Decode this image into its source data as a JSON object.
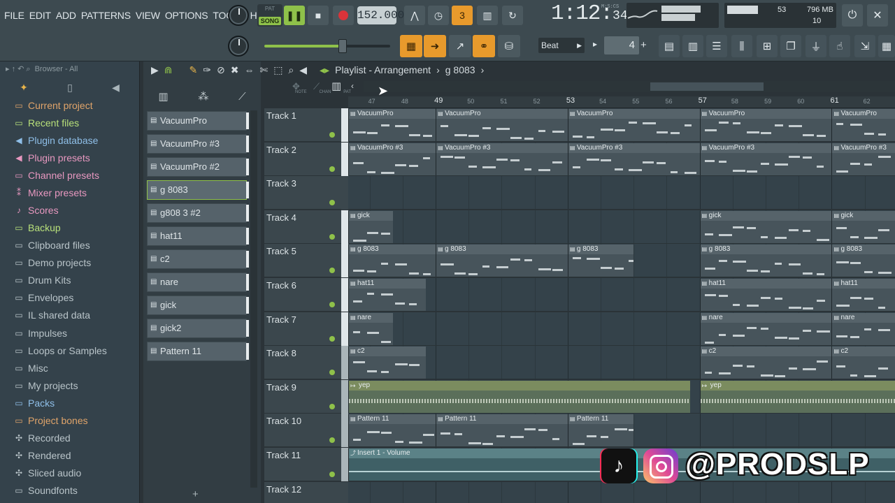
{
  "menu": [
    "FILE",
    "EDIT",
    "ADD",
    "PATTERNS",
    "VIEW",
    "OPTIONS",
    "TOOLS",
    "HELP"
  ],
  "transport": {
    "pat_label": "PAT",
    "song_label": "SONG",
    "tempo": "152.000",
    "time_main": "1:12:",
    "time_small": "34",
    "time_unit": "M:S:CS"
  },
  "cpu": {
    "cpu": "53",
    "memory": "796 MB",
    "polyphony": "10"
  },
  "snap": {
    "label": "Beat",
    "step": "4"
  },
  "browser": {
    "title": "Browser - All",
    "items": [
      {
        "label": "Current project",
        "icon": "folder-icon",
        "color": "#e0a46a"
      },
      {
        "label": "Recent files",
        "icon": "folder-icon",
        "color": "#b8e07a"
      },
      {
        "label": "Plugin database",
        "icon": "plug-icon",
        "color": "#8fbfe8"
      },
      {
        "label": "Plugin presets",
        "icon": "plug-icon",
        "color": "#e898c0"
      },
      {
        "label": "Channel presets",
        "icon": "folder-icon",
        "color": "#e898c0"
      },
      {
        "label": "Mixer presets",
        "icon": "mixer-icon",
        "color": "#e898c0"
      },
      {
        "label": "Scores",
        "icon": "note-icon",
        "color": "#e898c0"
      },
      {
        "label": "Backup",
        "icon": "folder-icon",
        "color": "#b8e07a"
      },
      {
        "label": "Clipboard files",
        "icon": "folder-icon",
        "color": "#b9c4c9"
      },
      {
        "label": "Demo projects",
        "icon": "folder-icon",
        "color": "#b9c4c9"
      },
      {
        "label": "Drum Kits",
        "icon": "folder-icon",
        "color": "#b9c4c9"
      },
      {
        "label": "Envelopes",
        "icon": "folder-icon",
        "color": "#b9c4c9"
      },
      {
        "label": "IL shared data",
        "icon": "folder-icon",
        "color": "#b9c4c9"
      },
      {
        "label": "Impulses",
        "icon": "folder-icon",
        "color": "#b9c4c9"
      },
      {
        "label": "Loops or Samples",
        "icon": "folder-icon",
        "color": "#b9c4c9"
      },
      {
        "label": "Misc",
        "icon": "folder-icon",
        "color": "#b9c4c9"
      },
      {
        "label": "My projects",
        "icon": "folder-icon",
        "color": "#b9c4c9"
      },
      {
        "label": "Packs",
        "icon": "folder-icon",
        "color": "#8fbfe8"
      },
      {
        "label": "Project bones",
        "icon": "folder-icon",
        "color": "#e0a46a"
      },
      {
        "label": "Recorded",
        "icon": "mic-icon",
        "color": "#b9c4c9"
      },
      {
        "label": "Rendered",
        "icon": "mic-icon",
        "color": "#b9c4c9"
      },
      {
        "label": "Sliced audio",
        "icon": "mic-icon",
        "color": "#b9c4c9"
      },
      {
        "label": "Soundfonts",
        "icon": "folder-icon",
        "color": "#b9c4c9"
      }
    ]
  },
  "patterns": [
    "VacuumPro",
    "VacuumPro #3",
    "VacuumPro #2",
    "g 8083",
    "g808 3 #2",
    "hat11",
    "c2",
    "nare",
    "gick",
    "gick2",
    "Pattern 11"
  ],
  "selected_pattern": 3,
  "playlist": {
    "title": "Playlist - Arrangement",
    "pattern": "g 8083",
    "ruler_start": 46,
    "ruler_end": 62,
    "major_bars": [
      49,
      53,
      57,
      61
    ],
    "chan_labels": [
      "NOTE",
      "CHAN",
      "PAT"
    ]
  },
  "tracks": [
    {
      "name": "Track 1",
      "clips": [
        {
          "label": "VacuumPro",
          "start": 46,
          "len": 3.5
        },
        {
          "label": "VacuumPro",
          "start": 49,
          "len": 4
        },
        {
          "label": "VacuumPro",
          "start": 53,
          "len": 4
        },
        {
          "label": "VacuumPro",
          "start": 57,
          "len": 4
        },
        {
          "label": "VacuumPro",
          "start": 61,
          "len": 2
        }
      ]
    },
    {
      "name": "Track 2",
      "clips": [
        {
          "label": "VacuumPro #3",
          "start": 46,
          "len": 3.5
        },
        {
          "label": "VacuumPro #3",
          "start": 49,
          "len": 4
        },
        {
          "label": "VacuumPro #3",
          "start": 53,
          "len": 4
        },
        {
          "label": "VacuumPro #3",
          "start": 57,
          "len": 4
        },
        {
          "label": "VacuumPro #3",
          "start": 61,
          "len": 2
        }
      ]
    },
    {
      "name": "Track 3",
      "clips": []
    },
    {
      "name": "Track 4",
      "clips": [
        {
          "label": "gick",
          "start": 46,
          "len": 1.7
        },
        {
          "label": "gick",
          "start": 57,
          "len": 4
        },
        {
          "label": "gick",
          "start": 61,
          "len": 2
        }
      ]
    },
    {
      "name": "Track 5",
      "clips": [
        {
          "label": "g 8083",
          "start": 46,
          "len": 3
        },
        {
          "label": "g 8083",
          "start": 49,
          "len": 4
        },
        {
          "label": "g 8083",
          "start": 53,
          "len": 2
        },
        {
          "label": "g 8083",
          "start": 57,
          "len": 4
        },
        {
          "label": "g 8083",
          "start": 61,
          "len": 2
        }
      ]
    },
    {
      "name": "Track 6",
      "clips": [
        {
          "label": "hat11",
          "start": 46,
          "len": 2.7
        },
        {
          "label": "hat11",
          "start": 57,
          "len": 4
        },
        {
          "label": "hat11",
          "start": 61,
          "len": 2
        }
      ]
    },
    {
      "name": "Track 7",
      "clips": [
        {
          "label": "nare",
          "start": 46,
          "len": 1.7
        },
        {
          "label": "nare",
          "start": 57,
          "len": 4
        },
        {
          "label": "nare",
          "start": 61,
          "len": 2
        }
      ]
    },
    {
      "name": "Track 8",
      "clips": [
        {
          "label": "c2",
          "start": 46,
          "len": 2.7
        },
        {
          "label": "c2",
          "start": 57,
          "len": 4
        },
        {
          "label": "c2",
          "start": 61,
          "len": 2
        }
      ]
    },
    {
      "name": "Track 9",
      "clips": [
        {
          "label": "yep",
          "start": 46,
          "len": 10.7,
          "kind": "audio"
        },
        {
          "label": "yep",
          "start": 57,
          "len": 6,
          "kind": "audio"
        }
      ]
    },
    {
      "name": "Track 10",
      "clips": [
        {
          "label": "Pattern 11",
          "start": 46,
          "len": 3
        },
        {
          "label": "Pattern 11",
          "start": 49,
          "len": 4
        },
        {
          "label": "Pattern 11",
          "start": 53,
          "len": 2
        }
      ]
    },
    {
      "name": "Track 11",
      "clips": [
        {
          "label": "Insert 1 - Volume",
          "start": 46,
          "len": 17,
          "kind": "auto"
        }
      ]
    },
    {
      "name": "Track 12",
      "clips": []
    }
  ],
  "watermark": {
    "handle": "@PRODSLP"
  }
}
